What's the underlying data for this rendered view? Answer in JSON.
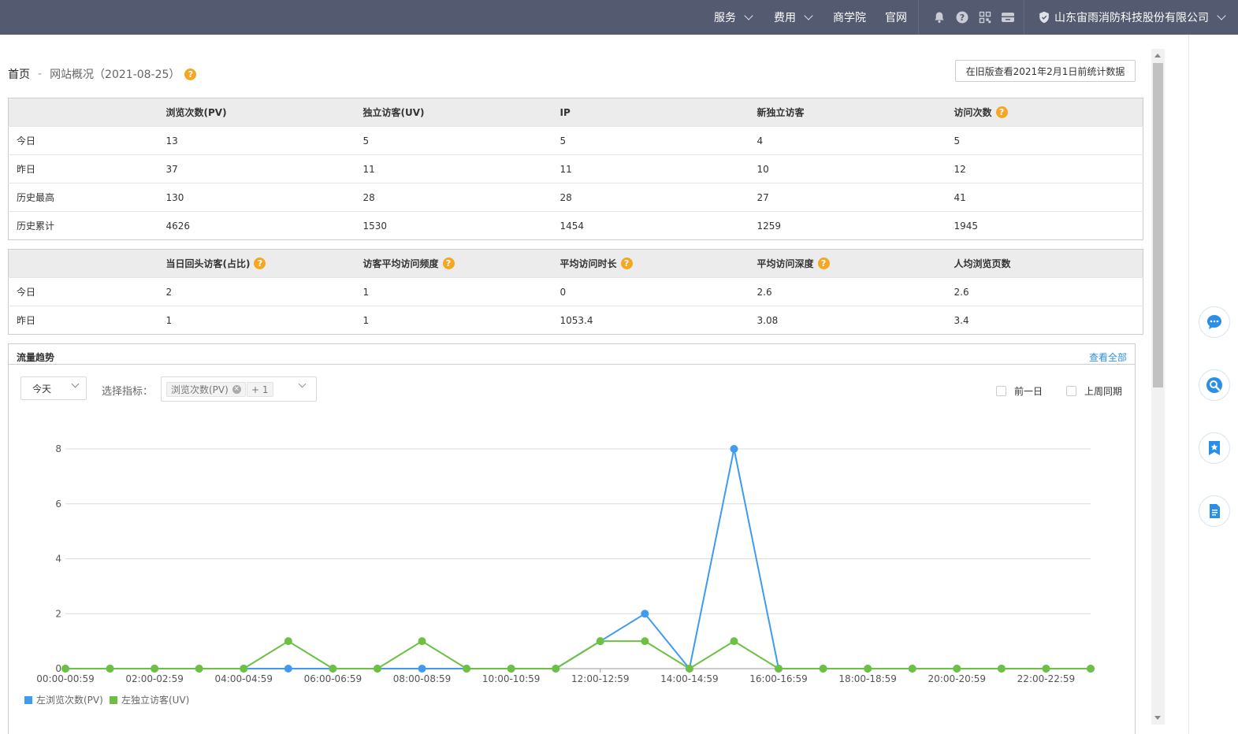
{
  "topbar": {
    "nav": [
      {
        "label": "服务",
        "dropdown": true
      },
      {
        "label": "费用",
        "dropdown": true
      },
      {
        "label": "商学院",
        "dropdown": false
      },
      {
        "label": "官网",
        "dropdown": false
      }
    ],
    "icons": [
      "bell-icon",
      "help-icon",
      "qrcode-icon",
      "store-icon"
    ],
    "company": "山东宙雨消防科技股份有限公司"
  },
  "breadcrumb": {
    "home": "首页",
    "separator": "-",
    "current": "网站概况（2021-08-25）"
  },
  "old_version_button": "在旧版查看2021年2月1日前统计数据",
  "table1": {
    "headers": [
      "",
      "浏览次数(PV)",
      "独立访客(UV)",
      "IP",
      "新独立访客",
      "访问次数"
    ],
    "help_on": [
      5
    ],
    "rows": [
      [
        "今日",
        "13",
        "5",
        "5",
        "4",
        "5"
      ],
      [
        "昨日",
        "37",
        "11",
        "11",
        "10",
        "12"
      ],
      [
        "历史最高",
        "130",
        "28",
        "28",
        "27",
        "41"
      ],
      [
        "历史累计",
        "4626",
        "1530",
        "1454",
        "1259",
        "1945"
      ]
    ]
  },
  "table2": {
    "headers": [
      "",
      "当日回头访客(占比)",
      "访客平均访问频度",
      "平均访问时长",
      "平均访问深度",
      "人均浏览页数"
    ],
    "help_on": [
      1,
      2,
      3,
      4
    ],
    "rows": [
      [
        "今日",
        "2",
        "1",
        "0",
        "2.6",
        "2.6"
      ],
      [
        "昨日",
        "1",
        "1",
        "1053.4",
        "3.08",
        "3.4"
      ]
    ]
  },
  "trend": {
    "title": "流量趋势",
    "view_all": "查看全部",
    "period_select": "今天",
    "metric_label": "选择指标：",
    "metric_tag": "浏览次数(PV)",
    "metric_more": "+ 1",
    "compare": [
      "前一日",
      "上周同期"
    ]
  },
  "chart_data": {
    "type": "line",
    "x": [
      "00:00-00:59",
      "01:00-01:59",
      "02:00-02:59",
      "03:00-03:59",
      "04:00-04:59",
      "05:00-05:59",
      "06:00-06:59",
      "07:00-07:59",
      "08:00-08:59",
      "09:00-09:59",
      "10:00-10:59",
      "11:00-11:59",
      "12:00-12:59",
      "13:00-13:59",
      "14:00-14:59",
      "15:00-15:59",
      "16:00-16:59",
      "17:00-17:59",
      "18:00-18:59",
      "19:00-19:59",
      "20:00-20:59",
      "21:00-21:59",
      "22:00-22:59",
      "23:00-23:59"
    ],
    "x_tick_labels_every": 2,
    "yticks": [
      0,
      2,
      4,
      6,
      8
    ],
    "ylim": [
      0,
      8
    ],
    "grid": true,
    "legend_position": "bottom-left",
    "series": [
      {
        "name": "左浏览次数(PV)",
        "color": "#3e9bf0",
        "values": [
          0,
          0,
          0,
          0,
          0,
          0,
          0,
          0,
          0,
          0,
          0,
          0,
          1,
          2,
          0,
          8,
          0,
          0,
          0,
          0,
          0,
          0,
          0,
          0
        ]
      },
      {
        "name": "左独立访客(UV)",
        "color": "#6cc142",
        "values": [
          0,
          0,
          0,
          0,
          0,
          1,
          0,
          0,
          1,
          0,
          0,
          0,
          1,
          1,
          0,
          1,
          0,
          0,
          0,
          0,
          0,
          0,
          0,
          0
        ]
      }
    ]
  }
}
